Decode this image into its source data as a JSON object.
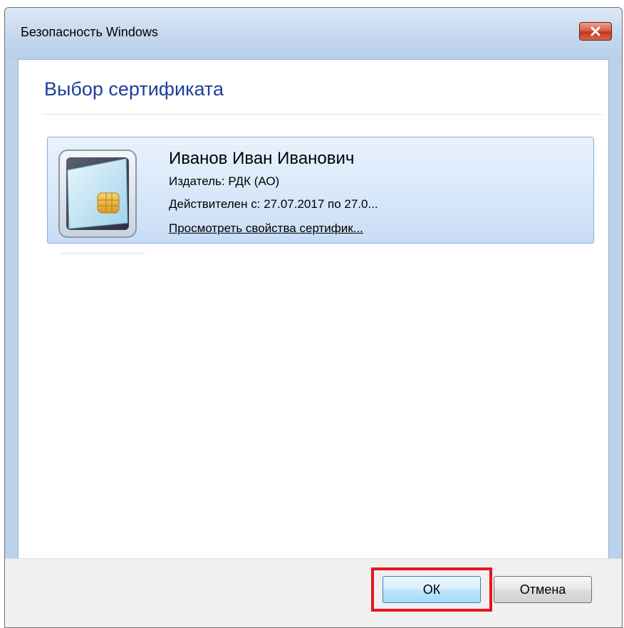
{
  "window": {
    "title": "Безопасность Windows"
  },
  "dialog": {
    "heading": "Выбор сертификата"
  },
  "certificate": {
    "name": "Иванов Иван Иванович",
    "issuer": "Издатель: РДК (АО)",
    "validity": "Действителен с: 27.07.2017 по 27.0...",
    "view_properties_link": "Просмотреть свойства сертифик...",
    "icon": "smart-card-icon"
  },
  "buttons": {
    "ok_label": "ОК",
    "cancel_label": "Отмена"
  },
  "colors": {
    "heading": "#1e3f9a",
    "highlight": "#e8131b",
    "close_button": "#c1361e"
  }
}
